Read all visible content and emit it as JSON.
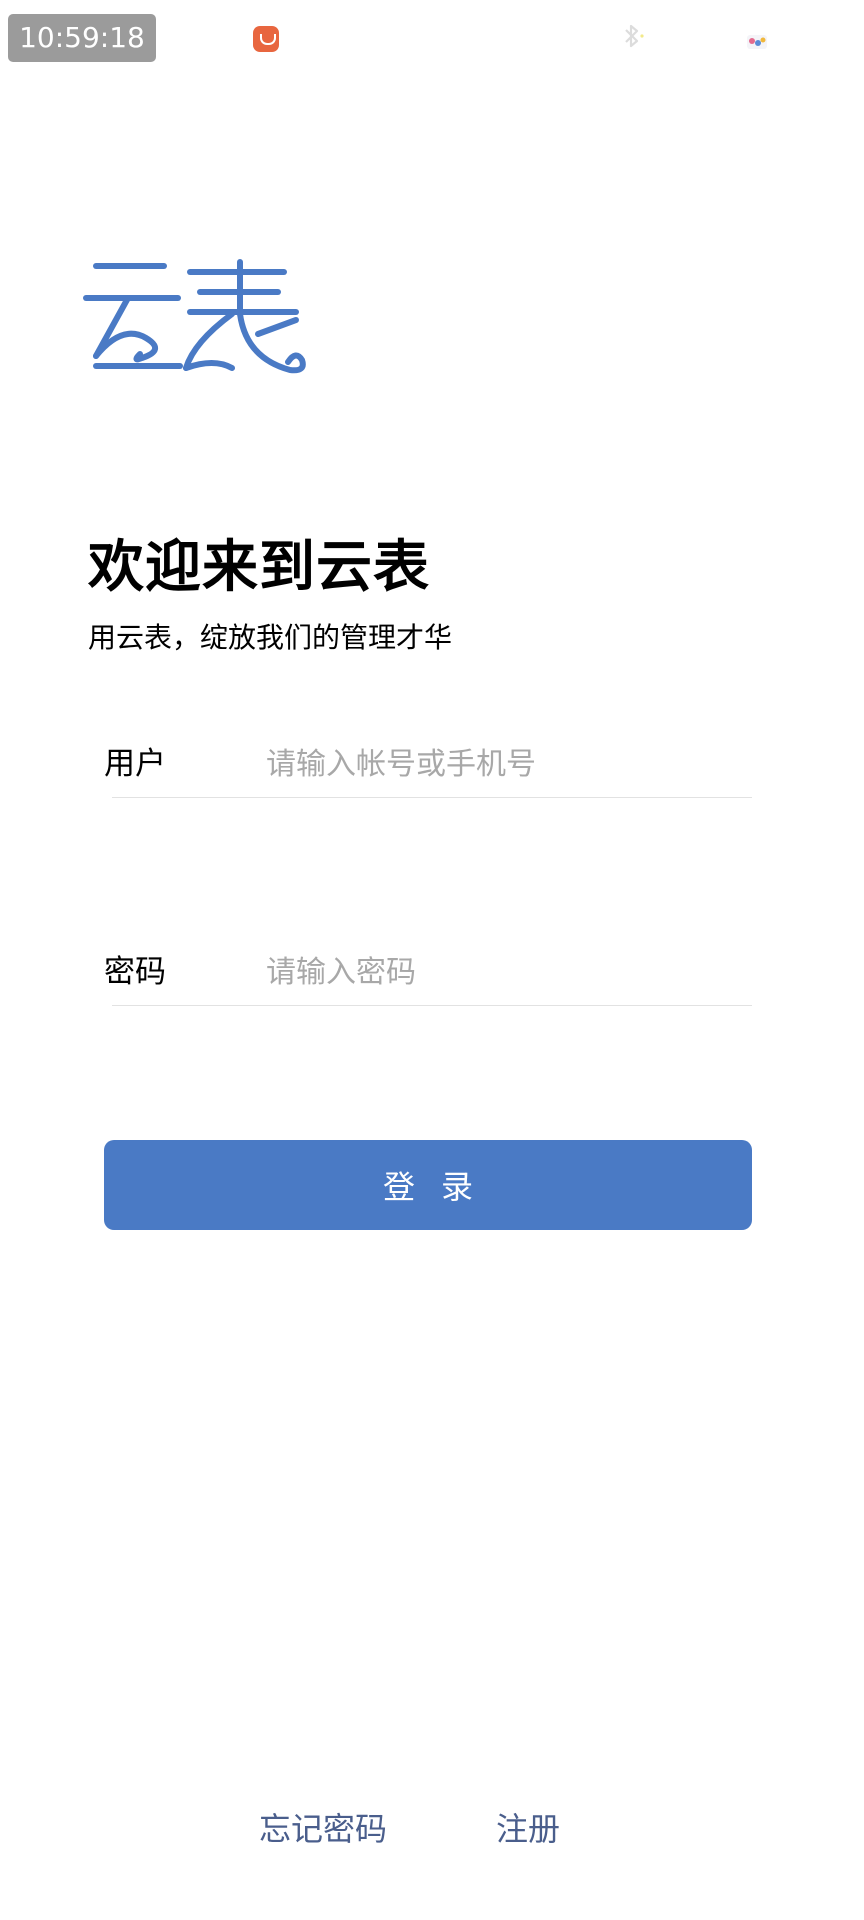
{
  "status_bar": {
    "time": "10:59:18",
    "icons": [
      "app-notification-icon",
      "bluetooth-icon",
      "app-badge-icon"
    ]
  },
  "logo": {
    "text": "云表",
    "color": "#4a7ac5"
  },
  "welcome": {
    "title": "欢迎来到云表",
    "subtitle": "用云表，绽放我们的管理才华"
  },
  "form": {
    "user_label": "用户",
    "user_placeholder": "请输入帐号或手机号",
    "user_value": "",
    "password_label": "密码",
    "password_placeholder": "请输入密码",
    "password_value": "",
    "login_button": "登录"
  },
  "footer": {
    "forgot_password": "忘记密码",
    "register": "注册"
  },
  "colors": {
    "accent": "#4a7ac5",
    "link": "#4a5e8c",
    "placeholder": "#a8a8a8"
  }
}
